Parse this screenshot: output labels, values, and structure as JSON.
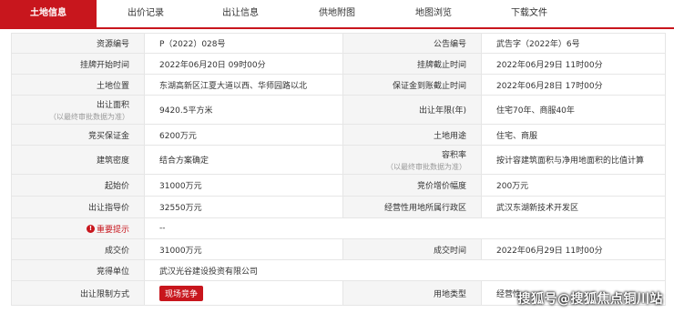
{
  "tabs": [
    {
      "label": "土地信息",
      "active": true
    },
    {
      "label": "出价记录",
      "active": false
    },
    {
      "label": "出让信息",
      "active": false
    },
    {
      "label": "供地附图",
      "active": false
    },
    {
      "label": "地图浏览",
      "active": false
    },
    {
      "label": "下载文件",
      "active": false
    }
  ],
  "rows": {
    "r1": {
      "l1": "资源编号",
      "v1": "P（2022）028号",
      "l2": "公告编号",
      "v2": "武告字（2022年）6号"
    },
    "r2": {
      "l1": "挂牌开始时间",
      "v1": "2022年06月20日 09时00分",
      "l2": "挂牌截止时间",
      "v2": "2022年06月29日 11时00分"
    },
    "r3": {
      "l1": "土地位置",
      "v1": "东湖高新区江夏大道以西、华师园路以北",
      "l2": "保证金到账截止时间",
      "v2": "2022年06月28日 17时00分"
    },
    "r4": {
      "l1": "出让面积",
      "l1sub": "（以最终审批数据为准）",
      "v1": "9420.5平方米",
      "l2": "出让年限(年)",
      "v2": "住宅70年、商服40年"
    },
    "r5": {
      "l1": "竞买保证金",
      "v1": "6200万元",
      "l2": "土地用途",
      "v2": "住宅、商服"
    },
    "r6": {
      "l1": "建筑密度",
      "v1": "结合方案确定",
      "l2": "容积率",
      "l2sub": "（以最终审批数据为准）",
      "v2": "按计容建筑面积与净用地面积的比值计算"
    },
    "r7": {
      "l1": "起始价",
      "v1": "31000万元",
      "l2": "竞价增价幅度",
      "v2": "200万元"
    },
    "r8": {
      "l1": "出让指导价",
      "v1": "32550万元",
      "l2": "经营性用地所属行政区",
      "v2": "武汉东湖新技术开发区"
    },
    "r9": {
      "l1": "重要提示",
      "v1": "--"
    },
    "r10": {
      "l1": "成交价",
      "v1": "31000万元",
      "l2": "成交时间",
      "v2": "2022年06月29日 11时00分"
    },
    "r11": {
      "l1": "竞得单位",
      "v1": "武汉光谷建设投资有限公司"
    },
    "r12": {
      "l1": "出让限制方式",
      "v1": "现场竞争",
      "l2": "用地类型",
      "v2": "经营性"
    }
  },
  "watermark": "搜狐号@搜狐焦点铜川站",
  "colors": {
    "accent": "#c8161d",
    "label_bg": "#f5f5f5",
    "border": "#e6e6e6"
  }
}
